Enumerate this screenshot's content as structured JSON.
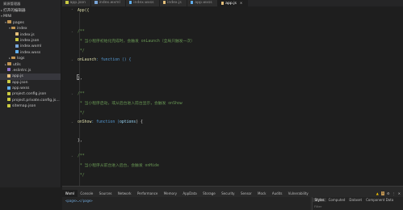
{
  "sidebar": {
    "title": "資源管理器",
    "open_editors": "打开的编辑器",
    "project": "MINI",
    "tree": [
      {
        "label": "pages",
        "type": "folder",
        "indent": 1,
        "chevron": "▾"
      },
      {
        "label": "index",
        "type": "folder",
        "indent": 2,
        "chevron": "▾"
      },
      {
        "label": "index.js",
        "type": "file",
        "indent": 3,
        "color": "#e5c07b"
      },
      {
        "label": "index.json",
        "type": "file",
        "indent": 3,
        "color": "#cbcb41"
      },
      {
        "label": "index.wxml",
        "type": "file",
        "indent": 3,
        "color": "#7aa6da"
      },
      {
        "label": "index.wxss",
        "type": "file",
        "indent": 3,
        "color": "#61afef"
      },
      {
        "label": "logs",
        "type": "folder",
        "indent": 2,
        "chevron": "▸"
      },
      {
        "label": "utils",
        "type": "folder",
        "indent": 1,
        "chevron": "▸"
      },
      {
        "label": ".eslintrc.js",
        "type": "file",
        "indent": 1,
        "color": "#8c6fc8"
      },
      {
        "label": "app.js",
        "type": "file",
        "indent": 1,
        "color": "#e5c07b",
        "active": true
      },
      {
        "label": "app.json",
        "type": "file",
        "indent": 1,
        "color": "#cbcb41"
      },
      {
        "label": "app.wxss",
        "type": "file",
        "indent": 1,
        "color": "#61afef"
      },
      {
        "label": "project.config.json",
        "type": "file",
        "indent": 1,
        "color": "#cbcb41"
      },
      {
        "label": "project.private.config.js...",
        "type": "file",
        "indent": 1,
        "color": "#cbcb41"
      },
      {
        "label": "sitemap.json",
        "type": "file",
        "indent": 1,
        "color": "#cbcb41"
      }
    ]
  },
  "tabs": [
    {
      "label": "app.json",
      "color": "#cbcb41",
      "active": false
    },
    {
      "label": "index.wxml",
      "color": "#7aa6da",
      "active": false
    },
    {
      "label": "index.wxss",
      "color": "#61afef",
      "active": false
    },
    {
      "label": "index.js",
      "color": "#e5c07b",
      "active": false
    },
    {
      "label": "app.wxss",
      "color": "#61afef",
      "active": false
    },
    {
      "label": "app.js",
      "color": "#e5c07b",
      "active": true
    }
  ],
  "code": {
    "line1": "App({",
    "c1_open": "/**",
    "c1_text": " * 当小程序初始化完成时，会触发 onLaunch（全局只触发一次）",
    "c1_close": " */",
    "onlaunch_key": "onLaunch",
    "onlaunch_rest": ": function () {",
    "close1": "},",
    "c2_open": "/**",
    "c2_text": " * 当小程序启动，或从后台进入前台显示，会触发 onShow",
    "c2_close": " */",
    "onshow_key": "onShow",
    "onshow_mid": ": function (",
    "onshow_param": "options",
    "onshow_end": ") {",
    "close2": "},",
    "c3_open": "/**",
    "c3_text": " * 当小程序从前台进入后台，会触发 onHide",
    "c3_close": " */"
  },
  "devtools": {
    "tabs": [
      "Wxml",
      "Console",
      "Sources",
      "Network",
      "Performance",
      "Memory",
      "AppData",
      "Storage",
      "Security",
      "Sensor",
      "Mock",
      "Audits",
      "Vulnerability"
    ],
    "active_tab": "Wxml",
    "wxml_line": "<page>…</page>",
    "right_tabs": [
      "Styles",
      "Computed",
      "Dataset",
      "Component Data"
    ],
    "filter_placeholder": "Filter",
    "warning_count": "1"
  }
}
